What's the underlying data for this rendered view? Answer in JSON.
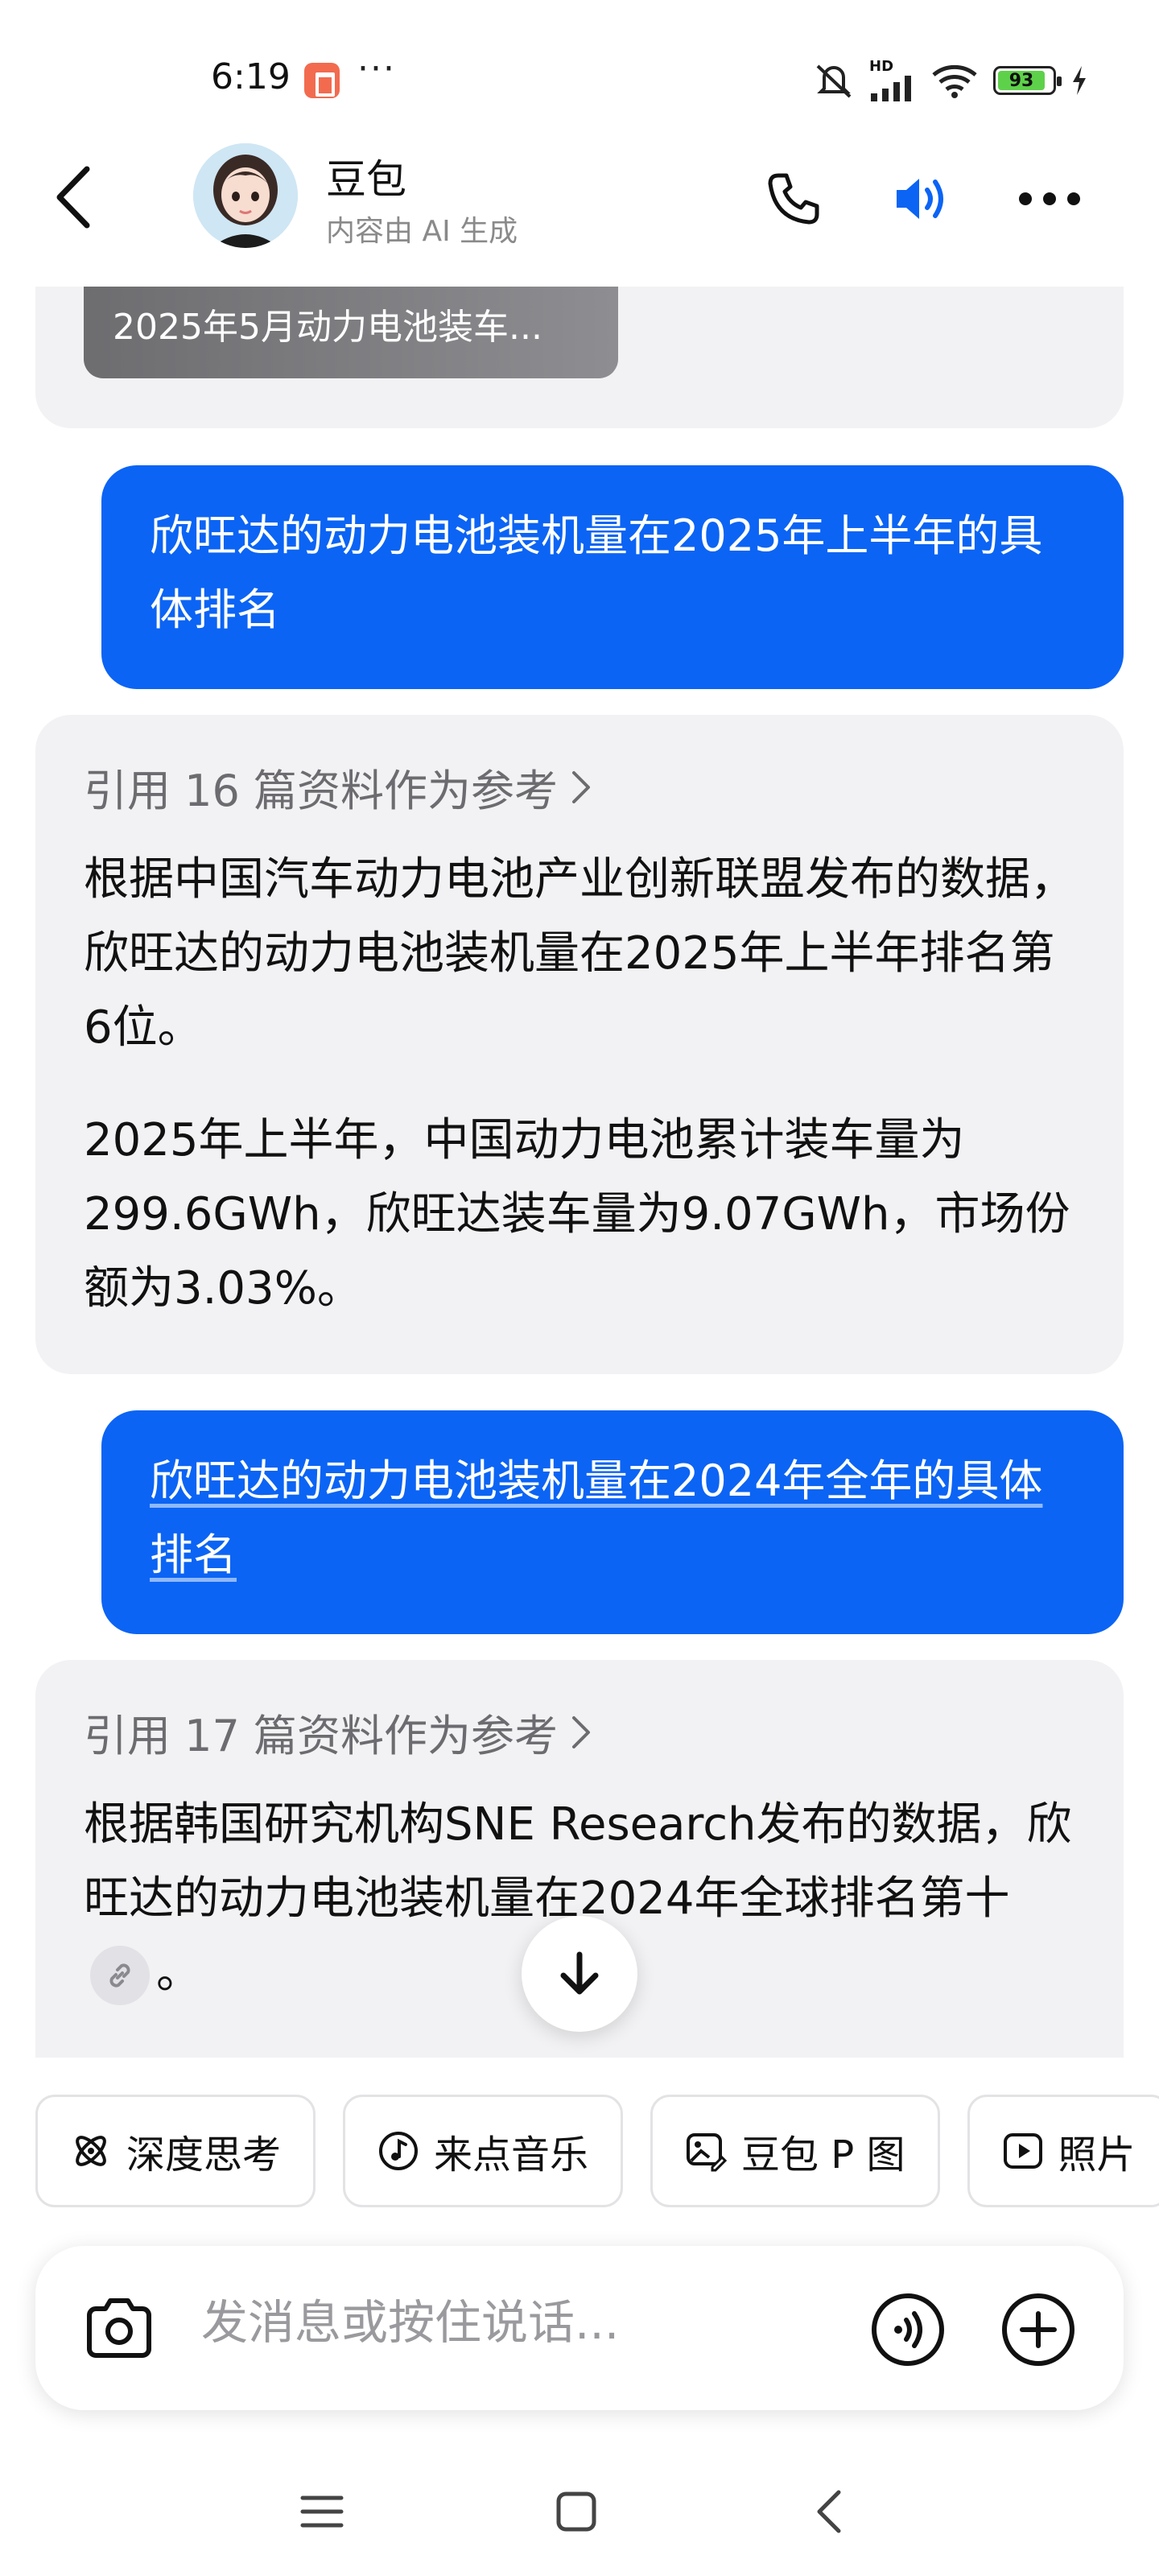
{
  "status_bar": {
    "time": "6:19",
    "more": "···",
    "battery_level": "93",
    "network_label": "HD"
  },
  "header": {
    "title": "豆包",
    "subtitle": "内容由 AI 生成",
    "icons": [
      "back-icon",
      "phone-icon",
      "speaker-icon",
      "more-icon"
    ]
  },
  "chat": {
    "prev_card_title": "2025年5月动力电池装车...",
    "messages": [
      {
        "role": "user",
        "text": "欣旺达的动力电池装机量在2025年上半年的具体排名"
      },
      {
        "role": "ai",
        "ref_text": "引用 16 篇资料作为参考",
        "paragraphs": [
          "根据中国汽车动力电池产业创新联盟发布的数据，欣旺达的动力电池装机量在2025年上半年排名第6位。",
          "2025年上半年，中国动力电池累计装车量为299.6GWh，欣旺达装车量为9.07GWh，市场份额为3.03%。"
        ]
      },
      {
        "role": "user",
        "text": "欣旺达的动力电池装机量在2024年全年的具体排名"
      },
      {
        "role": "ai",
        "ref_text": "引用 17 篇资料作为参考",
        "paragraph_before_link": "根据韩国研究机构SNE Research发布的数据，欣旺达的动力电池装机量在2024年全球排名第十",
        "paragraph_after_link": "。"
      }
    ]
  },
  "quick_actions": [
    {
      "label": "深度思考",
      "icon": "atom-icon"
    },
    {
      "label": "来点音乐",
      "icon": "music-icon"
    },
    {
      "label": "豆包 P 图",
      "icon": "image-edit-icon"
    },
    {
      "label": "照片",
      "icon": "video-icon"
    }
  ],
  "input": {
    "placeholder": "发消息或按住说话..."
  },
  "colors": {
    "accent": "#0b64f4",
    "ai_bubble": "#f2f2f4",
    "battery": "#5ed14a"
  }
}
